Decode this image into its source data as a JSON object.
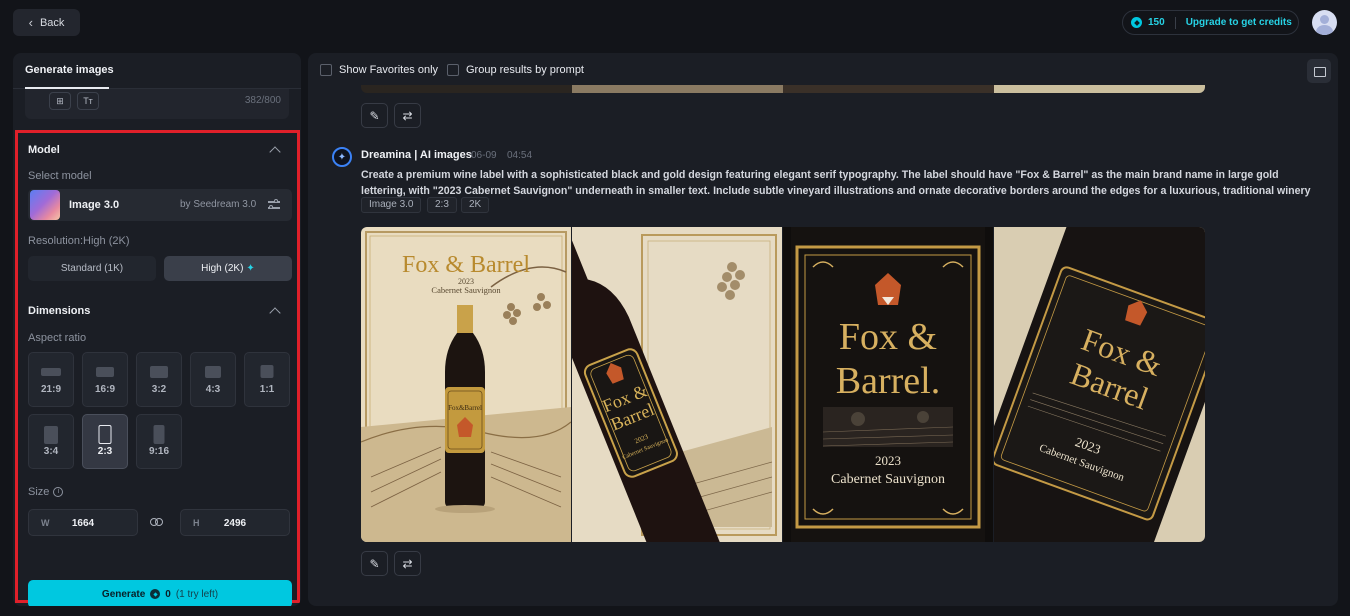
{
  "topbar": {
    "back_label": "Back",
    "credits": "150",
    "upgrade_label": "Upgrade to get credits"
  },
  "left": {
    "tab": "Generate images",
    "counter": "382/800",
    "model_section": "Model",
    "select_model_label": "Select model",
    "model_name": "Image 3.0",
    "model_by": "by Seedream 3.0",
    "resolution_label": "Resolution:High (2K)",
    "res_standard": "Standard (1K)",
    "res_high": "High (2K)",
    "dimensions_section": "Dimensions",
    "aspect_label": "Aspect ratio",
    "ratios": [
      "21:9",
      "16:9",
      "3:2",
      "4:3",
      "1:1",
      "3:4",
      "2:3",
      "9:16"
    ],
    "selected_ratio": "2:3",
    "size_label": "Size",
    "width_key": "W",
    "width": "1664",
    "height_key": "H",
    "height": "2496",
    "generate_label": "Generate",
    "generate_cost": "0",
    "generate_try": "(1 try left)"
  },
  "main": {
    "show_favorites": "Show Favorites only",
    "group_by_prompt": "Group results by prompt",
    "bot_name": "Dreamina | AI images",
    "date": "06-09",
    "time": "04:54",
    "prompt": "Create a premium wine label with a sophisticated black and gold design featuring elegant serif typography. The label should have \"Fox & Barrel\" as the main brand name in large gold lettering, with \"2023 Cabernet Sauvignon\" underneath in smaller text. Include subtle vineyard illustrations and ornate decorative borders around the edges for a luxurious, traditional winery aesthetic.",
    "chips": [
      "Image 3.0",
      "2:3",
      "2K"
    ],
    "images": [
      {
        "brand_line1": "Fox & Barrel",
        "year": "2023",
        "varietal": "Cabernet Sauvignon",
        "bottle_label": "Fox&Barrel"
      },
      {
        "brand_line1": "Fox &",
        "brand_line2": "Barrel",
        "year": "2023",
        "varietal": "Cabernet Sauvignon"
      },
      {
        "brand_line1": "Fox &",
        "brand_line2": "Barrel.",
        "year": "2023",
        "varietal": "Cabernet Sauvignon"
      },
      {
        "brand_line1": "Fox &",
        "brand_line2": "Barrel",
        "year": "2023",
        "varietal": "Cabernet Sauvignon"
      }
    ]
  },
  "colors": {
    "accent": "#00c8e0",
    "highlight_border": "#e0202a",
    "gold": "#c9a24a"
  }
}
